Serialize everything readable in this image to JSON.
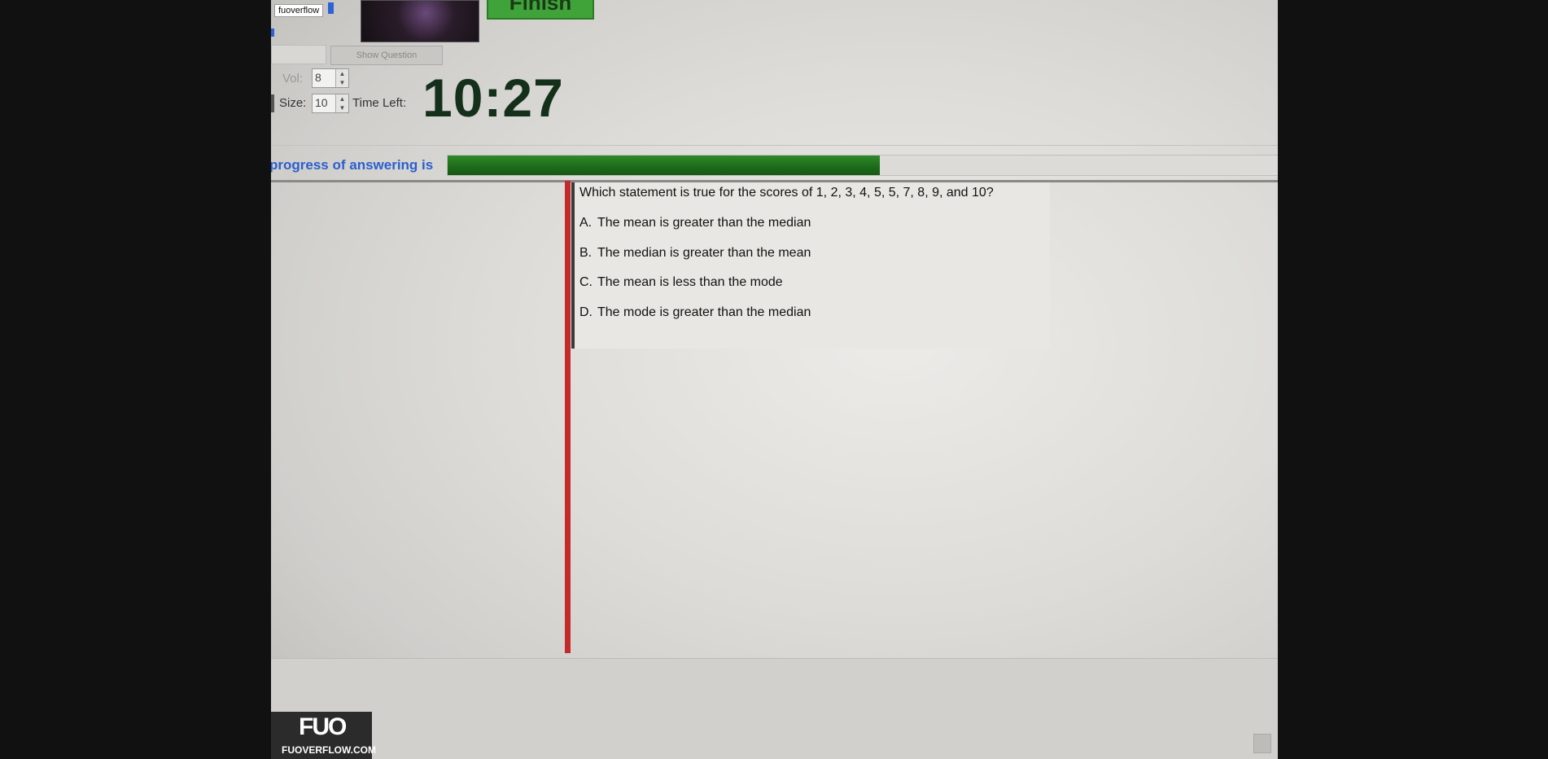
{
  "watermark_tag": "fuoverflow",
  "finish_button": "Finish",
  "show_question_button": "Show Question",
  "controls": {
    "vol_label": "Vol:",
    "vol_value": "8",
    "size_label": "Size:",
    "size_value": "10",
    "time_left_label": "Time Left:",
    "timer": "10:27"
  },
  "progress": {
    "label": "progress of answering is",
    "fraction": 0.52
  },
  "question": {
    "text": "Which statement is true for the scores of 1, 2, 3, 4, 5, 5, 7, 8, 9, and 10?",
    "options": [
      {
        "letter": "A.",
        "text": "The mean is greater than the median"
      },
      {
        "letter": "B.",
        "text": "The median is greater than the mean"
      },
      {
        "letter": "C.",
        "text": "The mean is less than the mode"
      },
      {
        "letter": "D.",
        "text": "The mode is greater than the median"
      }
    ]
  },
  "logo": {
    "mark": "FUO",
    "site": "FUOVERFLOW.COM"
  },
  "colors": {
    "progress_fill": "#1f6e1c",
    "timer": "#14301a",
    "progress_label": "#2a5fd0",
    "red_bar": "#c42a2a"
  }
}
